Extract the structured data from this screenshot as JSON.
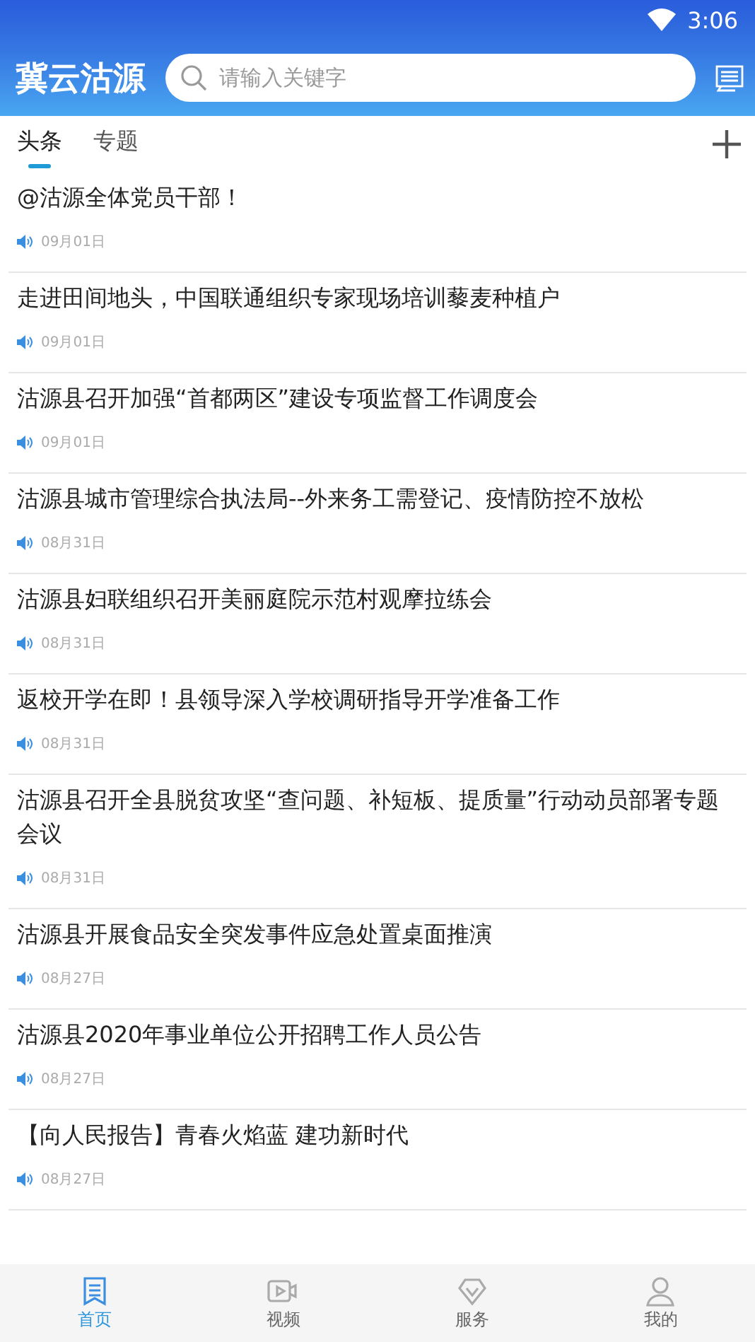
{
  "status_bar": {
    "time": "3:06"
  },
  "header": {
    "title": "冀云沽源",
    "search": {
      "placeholder": "请输入关键字"
    }
  },
  "tabs": [
    {
      "label": "头条",
      "selected": true
    },
    {
      "label": "专题",
      "selected": false
    }
  ],
  "news": [
    {
      "title": "@沽源全体党员干部！",
      "date": "09月01日"
    },
    {
      "title": "走进田间地头，中国联通组织专家现场培训藜麦种植户",
      "date": "09月01日"
    },
    {
      "title": "沽源县召开加强“首都两区”建设专项监督工作调度会",
      "date": "09月01日"
    },
    {
      "title": "沽源县城市管理综合执法局--外来务工需登记、疫情防控不放松",
      "date": "08月31日"
    },
    {
      "title": "沽源县妇联组织召开美丽庭院示范村观摩拉练会",
      "date": "08月31日"
    },
    {
      "title": "返校开学在即！县领导深入学校调研指导开学准备工作",
      "date": "08月31日"
    },
    {
      "title": "沽源县召开全县脱贫攻坚“查问题、补短板、提质量”行动动员部署专题会议",
      "date": "08月31日"
    },
    {
      "title": "沽源县开展食品安全突发事件应急处置桌面推演",
      "date": "08月27日"
    },
    {
      "title": "沽源县2020年事业单位公开招聘工作人员公告",
      "date": "08月27日"
    },
    {
      "title": "【向人民报告】青春火焰蓝 建功新时代",
      "date": "08月27日"
    }
  ],
  "bottom_nav": [
    {
      "kind": "home",
      "label": "首页",
      "selected": true
    },
    {
      "kind": "video",
      "label": "视频",
      "selected": false
    },
    {
      "kind": "service",
      "label": "服务",
      "selected": false
    },
    {
      "kind": "mine",
      "label": "我的",
      "selected": false
    }
  ]
}
